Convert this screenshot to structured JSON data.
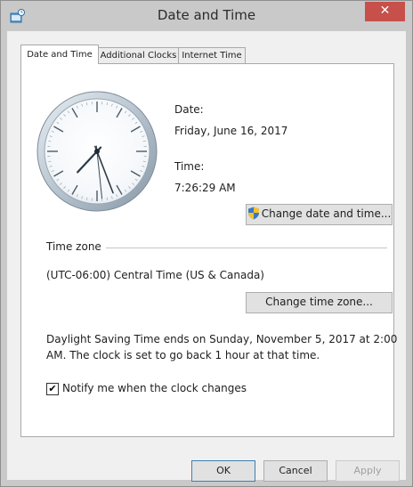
{
  "window": {
    "title": "Date and Time",
    "close_glyph": "✕"
  },
  "tabs": [
    {
      "label": "Date and Time",
      "active": true
    },
    {
      "label": "Additional Clocks",
      "active": false
    },
    {
      "label": "Internet Time",
      "active": false
    }
  ],
  "clock": {
    "hours": 7,
    "minutes": 26,
    "seconds": 29
  },
  "datetime": {
    "date_label": "Date:",
    "date_value": "Friday, June 16, 2017",
    "time_label": "Time:",
    "time_value": "7:26:29 AM",
    "change_button": "Change date and time...",
    "change_button_icon": "uac-shield-icon"
  },
  "timezone": {
    "group_label": "Time zone",
    "value": "(UTC-06:00) Central Time (US & Canada)",
    "change_button": "Change time zone..."
  },
  "dst": {
    "line1": "Daylight Saving Time ends on Sunday, November 5, 2017 at 2:00",
    "line2": "AM. The clock is set to go back 1 hour at that time."
  },
  "notify": {
    "label": "Notify me when the clock changes",
    "checked": true,
    "check_glyph": "✔"
  },
  "footer": {
    "ok": "OK",
    "cancel": "Cancel",
    "apply": "Apply"
  },
  "colors": {
    "close_button": "#c7504a",
    "chrome": "#c9c9c9",
    "panel": "#ffffff"
  }
}
